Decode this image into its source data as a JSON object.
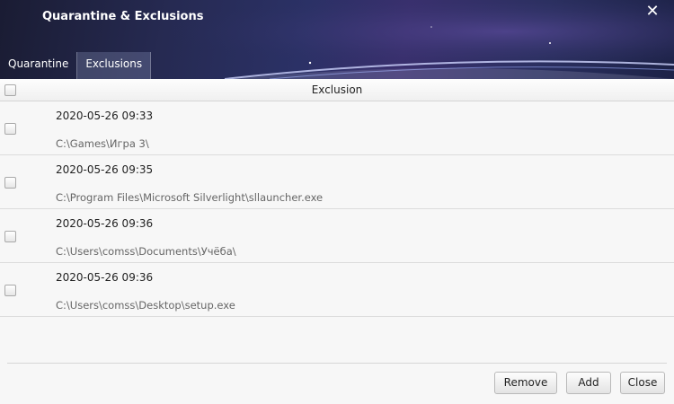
{
  "window": {
    "title": "Quarantine & Exclusions",
    "close_glyph": "✕"
  },
  "tabs": [
    {
      "label": "Quarantine",
      "active": false
    },
    {
      "label": "Exclusions",
      "active": true
    }
  ],
  "table": {
    "column_header": "Exclusion",
    "rows": [
      {
        "date": "2020-05-26 09:33",
        "path": "C:\\Games\\Игра 3\\"
      },
      {
        "date": "2020-05-26 09:35",
        "path": "C:\\Program Files\\Microsoft Silverlight\\sllauncher.exe"
      },
      {
        "date": "2020-05-26 09:36",
        "path": "C:\\Users\\comss\\Documents\\Учёба\\"
      },
      {
        "date": "2020-05-26 09:36",
        "path": "C:\\Users\\comss\\Desktop\\setup.exe"
      }
    ]
  },
  "buttons": {
    "remove": "Remove",
    "add": "Add",
    "close": "Close"
  }
}
